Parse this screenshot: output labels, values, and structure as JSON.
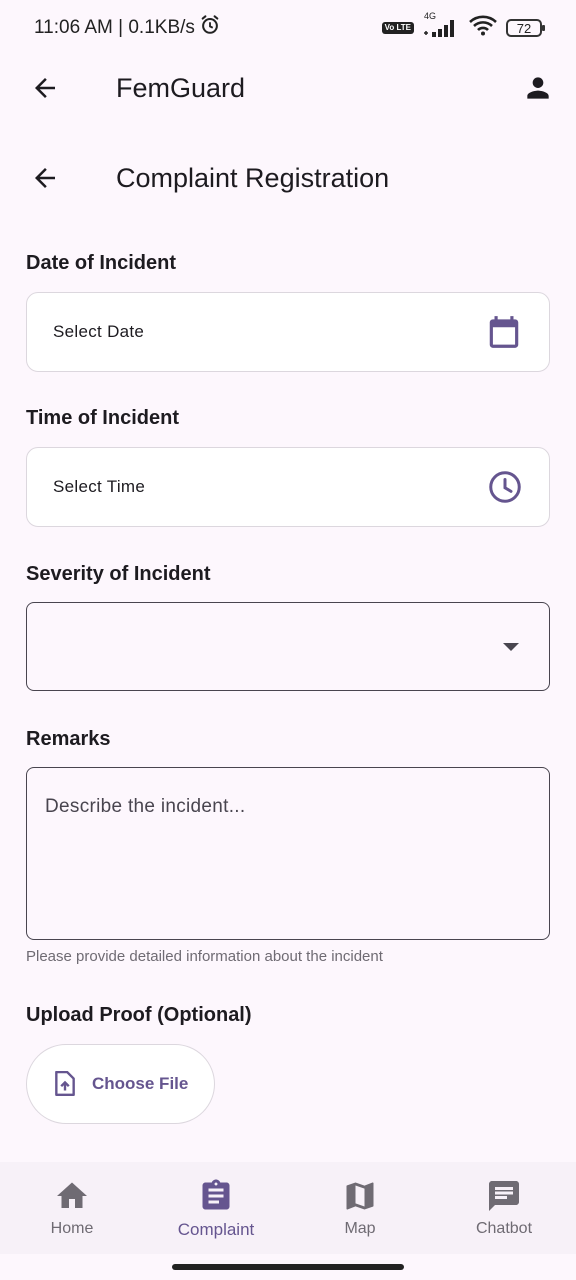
{
  "status_bar": {
    "time_speed": "11:06 AM | 0.1KB/s",
    "network": "4G",
    "volte": "Vo LTE",
    "battery": "72"
  },
  "app_bar": {
    "title": "FemGuard"
  },
  "page": {
    "title": "Complaint Registration"
  },
  "form": {
    "date_label": "Date of Incident",
    "date_value": "Select Date",
    "time_label": "Time of Incident",
    "time_value": "Select Time",
    "severity_label": "Severity of Incident",
    "remarks_label": "Remarks",
    "remarks_placeholder": "Describe the incident...",
    "remarks_helper": "Please provide detailed information about the incident",
    "upload_label": "Upload Proof (Optional)",
    "upload_button": "Choose File"
  },
  "bottom_nav": {
    "items": [
      {
        "label": "Home",
        "icon": "home-icon",
        "active": false
      },
      {
        "label": "Complaint",
        "icon": "clipboard-icon",
        "active": true
      },
      {
        "label": "Map",
        "icon": "map-icon",
        "active": false
      },
      {
        "label": "Chatbot",
        "icon": "chat-icon",
        "active": false
      }
    ]
  },
  "colors": {
    "background": "#fdf7fd",
    "accent": "#65558f",
    "nav_background": "#f7f1f8",
    "outline": "#49454f"
  }
}
